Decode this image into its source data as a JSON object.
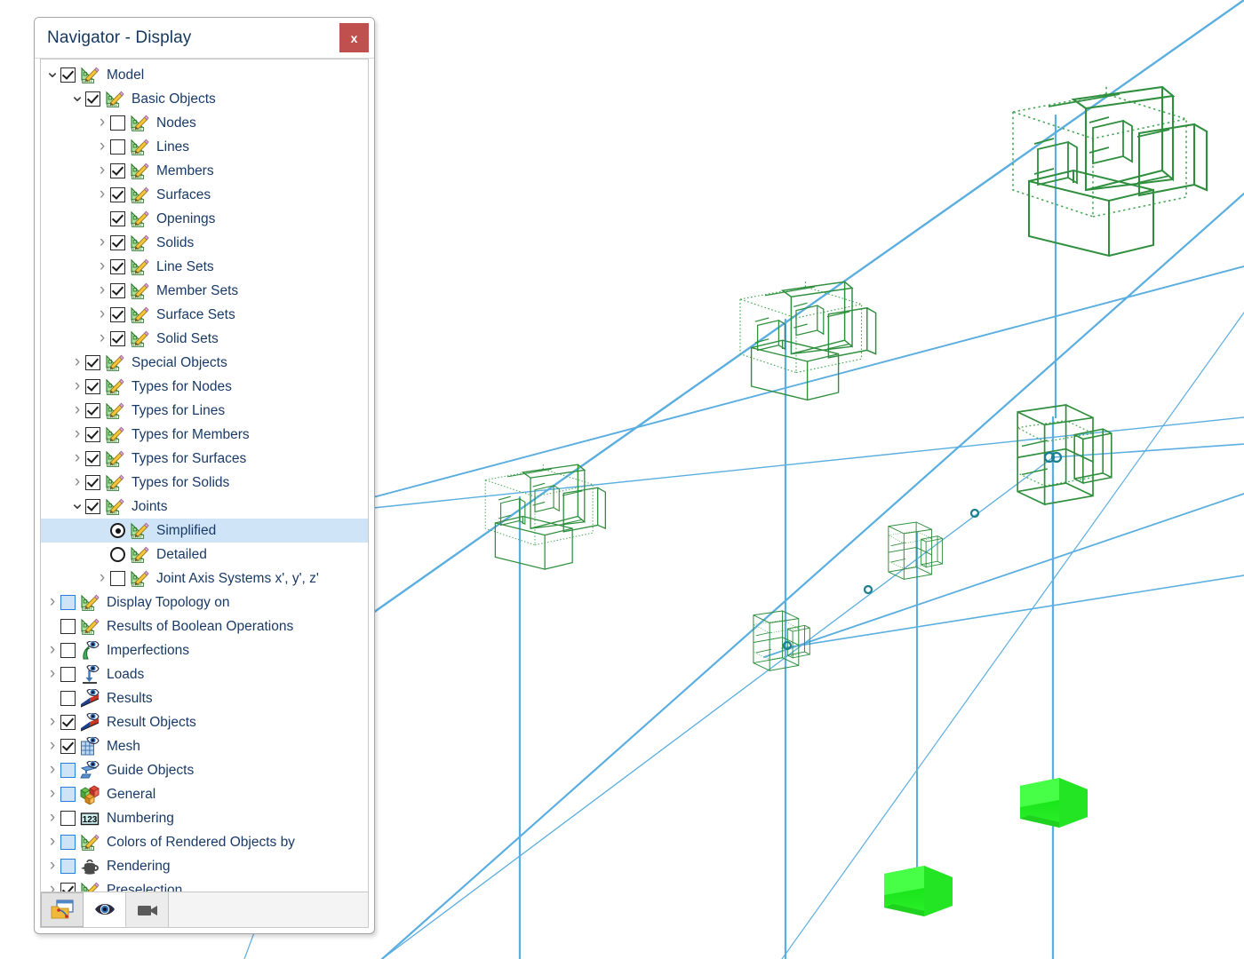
{
  "window": {
    "title": "Navigator - Display",
    "close_label": "x",
    "close_icon": "close-icon",
    "close_color": "#c0504d"
  },
  "tree": {
    "items": [
      {
        "label": "Model",
        "depth": 0,
        "arrow": "open",
        "control": "checkbox",
        "state": "checked",
        "icon": "ruler-pencil-icon",
        "selected": false
      },
      {
        "label": "Basic Objects",
        "depth": 1,
        "arrow": "open",
        "control": "checkbox",
        "state": "checked",
        "icon": "ruler-pencil-icon",
        "selected": false
      },
      {
        "label": "Nodes",
        "depth": 2,
        "arrow": "closed",
        "control": "checkbox",
        "state": "unchecked",
        "icon": "ruler-pencil-icon",
        "selected": false
      },
      {
        "label": "Lines",
        "depth": 2,
        "arrow": "closed",
        "control": "checkbox",
        "state": "unchecked",
        "icon": "ruler-pencil-icon",
        "selected": false
      },
      {
        "label": "Members",
        "depth": 2,
        "arrow": "closed",
        "control": "checkbox",
        "state": "checked",
        "icon": "ruler-pencil-icon",
        "selected": false
      },
      {
        "label": "Surfaces",
        "depth": 2,
        "arrow": "closed",
        "control": "checkbox",
        "state": "checked",
        "icon": "ruler-pencil-icon",
        "selected": false
      },
      {
        "label": "Openings",
        "depth": 2,
        "arrow": "none",
        "control": "checkbox",
        "state": "checked",
        "icon": "ruler-pencil-icon",
        "selected": false
      },
      {
        "label": "Solids",
        "depth": 2,
        "arrow": "closed",
        "control": "checkbox",
        "state": "checked",
        "icon": "ruler-pencil-icon",
        "selected": false
      },
      {
        "label": "Line Sets",
        "depth": 2,
        "arrow": "closed",
        "control": "checkbox",
        "state": "checked",
        "icon": "ruler-pencil-icon",
        "selected": false
      },
      {
        "label": "Member Sets",
        "depth": 2,
        "arrow": "closed",
        "control": "checkbox",
        "state": "checked",
        "icon": "ruler-pencil-icon",
        "selected": false
      },
      {
        "label": "Surface Sets",
        "depth": 2,
        "arrow": "closed",
        "control": "checkbox",
        "state": "checked",
        "icon": "ruler-pencil-icon",
        "selected": false
      },
      {
        "label": "Solid Sets",
        "depth": 2,
        "arrow": "closed",
        "control": "checkbox",
        "state": "checked",
        "icon": "ruler-pencil-icon",
        "selected": false
      },
      {
        "label": "Special Objects",
        "depth": 1,
        "arrow": "closed",
        "control": "checkbox",
        "state": "checked",
        "icon": "ruler-pencil-icon",
        "selected": false
      },
      {
        "label": "Types for Nodes",
        "depth": 1,
        "arrow": "closed",
        "control": "checkbox",
        "state": "checked",
        "icon": "ruler-pencil-icon",
        "selected": false
      },
      {
        "label": "Types for Lines",
        "depth": 1,
        "arrow": "closed",
        "control": "checkbox",
        "state": "checked",
        "icon": "ruler-pencil-icon",
        "selected": false
      },
      {
        "label": "Types for Members",
        "depth": 1,
        "arrow": "closed",
        "control": "checkbox",
        "state": "checked",
        "icon": "ruler-pencil-icon",
        "selected": false
      },
      {
        "label": "Types for Surfaces",
        "depth": 1,
        "arrow": "closed",
        "control": "checkbox",
        "state": "checked",
        "icon": "ruler-pencil-icon",
        "selected": false
      },
      {
        "label": "Types for Solids",
        "depth": 1,
        "arrow": "closed",
        "control": "checkbox",
        "state": "checked",
        "icon": "ruler-pencil-icon",
        "selected": false
      },
      {
        "label": "Joints",
        "depth": 1,
        "arrow": "open",
        "control": "checkbox",
        "state": "checked",
        "icon": "ruler-pencil-icon",
        "selected": false
      },
      {
        "label": "Simplified",
        "depth": 2,
        "arrow": "none",
        "control": "radio",
        "state": "on",
        "icon": "ruler-pencil-icon",
        "selected": true
      },
      {
        "label": "Detailed",
        "depth": 2,
        "arrow": "none",
        "control": "radio",
        "state": "off",
        "icon": "ruler-pencil-icon",
        "selected": false
      },
      {
        "label": "Joint Axis Systems x', y', z'",
        "depth": 2,
        "arrow": "closed",
        "control": "checkbox",
        "state": "unchecked",
        "icon": "ruler-pencil-icon",
        "selected": false
      },
      {
        "label": "Display Topology on",
        "depth": 0,
        "arrow": "closed",
        "control": "checkbox",
        "state": "partial",
        "icon": "ruler-pencil-icon",
        "selected": false
      },
      {
        "label": "Results of Boolean Operations",
        "depth": 0,
        "arrow": "none",
        "control": "checkbox",
        "state": "unchecked",
        "icon": "ruler-pencil-icon",
        "selected": false
      },
      {
        "label": "Imperfections",
        "depth": 0,
        "arrow": "closed",
        "control": "checkbox",
        "state": "unchecked",
        "icon": "imperfection-eye-icon",
        "selected": false
      },
      {
        "label": "Loads",
        "depth": 0,
        "arrow": "closed",
        "control": "checkbox",
        "state": "unchecked",
        "icon": "load-arrow-eye-icon",
        "selected": false
      },
      {
        "label": "Results",
        "depth": 0,
        "arrow": "none",
        "control": "checkbox",
        "state": "unchecked",
        "icon": "results-diagram-eye-icon",
        "selected": false
      },
      {
        "label": "Result Objects",
        "depth": 0,
        "arrow": "closed",
        "control": "checkbox",
        "state": "checked",
        "icon": "results-diagram-eye-icon",
        "selected": false
      },
      {
        "label": "Mesh",
        "depth": 0,
        "arrow": "closed",
        "control": "checkbox",
        "state": "checked",
        "icon": "mesh-grid-eye-icon",
        "selected": false
      },
      {
        "label": "Guide Objects",
        "depth": 0,
        "arrow": "closed",
        "control": "checkbox",
        "state": "partial",
        "icon": "guide-object-eye-icon",
        "selected": false
      },
      {
        "label": "General",
        "depth": 0,
        "arrow": "closed",
        "control": "checkbox",
        "state": "partial",
        "icon": "colored-cubes-icon",
        "selected": false
      },
      {
        "label": "Numbering",
        "depth": 0,
        "arrow": "closed",
        "control": "checkbox",
        "state": "unchecked",
        "icon": "numbering-123-icon",
        "selected": false
      },
      {
        "label": "Colors of Rendered Objects by",
        "depth": 0,
        "arrow": "closed",
        "control": "checkbox",
        "state": "partial",
        "icon": "ruler-pencil-icon",
        "selected": false
      },
      {
        "label": "Rendering",
        "depth": 0,
        "arrow": "closed",
        "control": "checkbox",
        "state": "partial",
        "icon": "teapot-icon",
        "selected": false
      },
      {
        "label": "Preselection",
        "depth": 0,
        "arrow": "closed",
        "control": "checkbox",
        "state": "checked",
        "icon": "ruler-pencil-icon",
        "selected": false
      }
    ]
  },
  "tabbar": {
    "tabs": [
      {
        "name": "project-navigator-tab",
        "icon": "folder-window-icon",
        "state": "pressed"
      },
      {
        "name": "display-navigator-tab",
        "icon": "eye-icon",
        "state": "active"
      },
      {
        "name": "views-navigator-tab",
        "icon": "video-camera-icon",
        "state": "normal"
      }
    ]
  },
  "viewport": {
    "name": "model-3d-viewport",
    "background": "#ffffff",
    "member_line_color": "#5aaee0",
    "joint_solid_color": "#2f8f3e",
    "joint_hidden_color": "#4aa85a",
    "support_color": "#22dd22",
    "node_marker_color": "#1b7f8e"
  }
}
